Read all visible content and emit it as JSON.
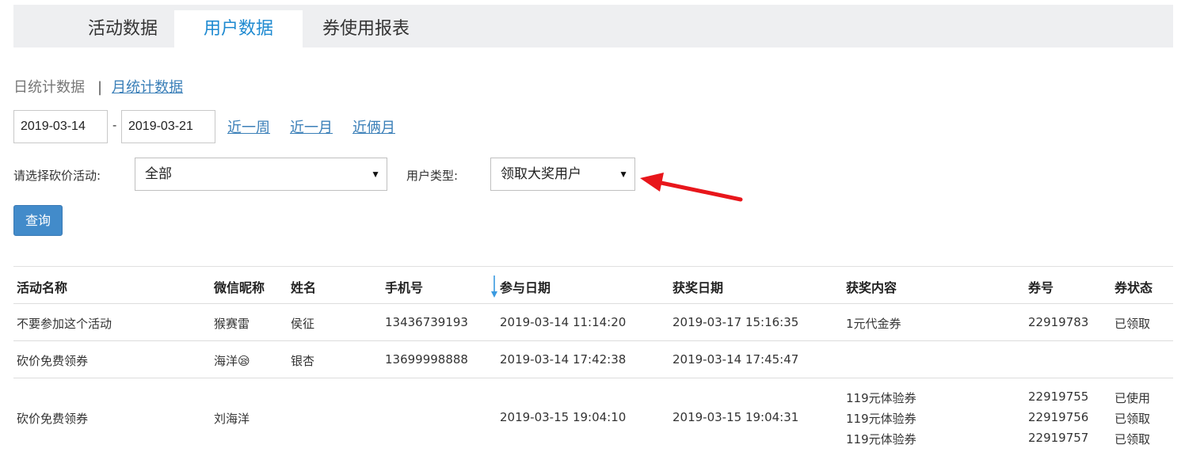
{
  "tabs": [
    {
      "label": "活动数据",
      "active": false
    },
    {
      "label": "用户数据",
      "active": true
    },
    {
      "label": "券使用报表",
      "active": false
    }
  ],
  "subnav": {
    "daily": "日统计数据",
    "separator": "|",
    "monthly": "月统计数据"
  },
  "filters": {
    "start_date": "2019-03-14",
    "date_separator": "-",
    "end_date": "2019-03-21",
    "quick_ranges": [
      "近一周",
      "近一月",
      "近俩月"
    ],
    "activity_label": "请选择砍价活动:",
    "activity_value": "全部",
    "user_type_label": "用户类型:",
    "user_type_value": "领取大奖用户",
    "query_button": "查询"
  },
  "annotation": {
    "arrow_color": "#e8161b"
  },
  "colors": {
    "accent": "#1e8ad1",
    "link": "#3a7fb8",
    "button": "#428bca"
  },
  "table": {
    "headers": [
      "活动名称",
      "微信昵称",
      "姓名",
      "手机号",
      "参与日期",
      "获奖日期",
      "获奖内容",
      "券号",
      "券状态"
    ],
    "rows": [
      {
        "activity": "不要参加这个活动",
        "nickname": "猴赛雷",
        "name": "侯征",
        "phone": "13436739193",
        "join_date": "2019-03-14 11:14:20",
        "win_date": "2019-03-17 15:16:35",
        "prizes": [
          {
            "content": "1元代金券",
            "coupon": "22919783",
            "status": "已领取"
          }
        ]
      },
      {
        "activity": "砍价免费领券",
        "nickname": "海洋",
        "nickname_emoji": "😪",
        "name": "银杏",
        "phone": "13699998888",
        "join_date": "2019-03-14 17:42:38",
        "win_date": "2019-03-14 17:45:47",
        "prizes": []
      },
      {
        "activity": "砍价免费领券",
        "nickname": "刘海洋",
        "name": "",
        "phone": "",
        "join_date": "2019-03-15 19:04:10",
        "win_date": "2019-03-15 19:04:31",
        "prizes": [
          {
            "content": "119元体验券",
            "coupon": "22919755",
            "status": "已使用"
          },
          {
            "content": "119元体验券",
            "coupon": "22919756",
            "status": "已领取"
          },
          {
            "content": "119元体验券",
            "coupon": "22919757",
            "status": "已领取"
          }
        ]
      }
    ]
  }
}
